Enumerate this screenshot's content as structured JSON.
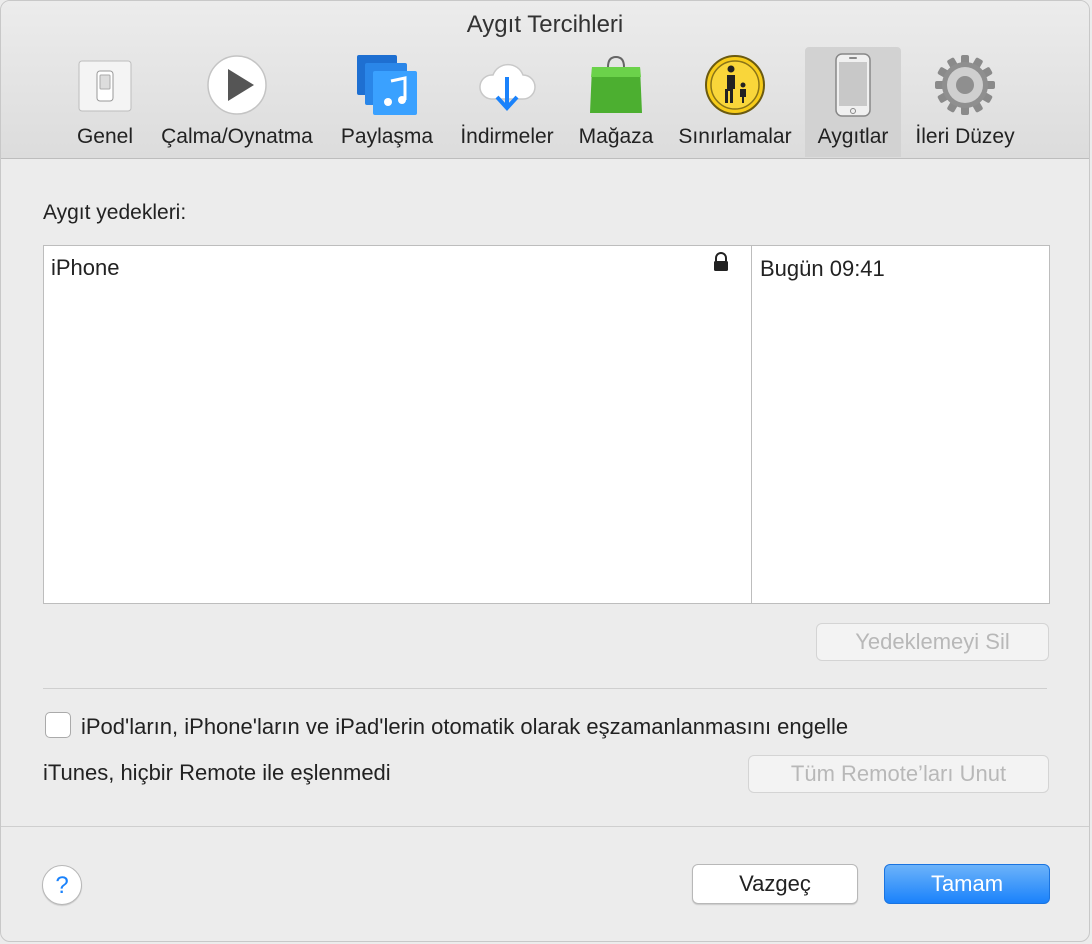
{
  "window": {
    "title": "Aygıt Tercihleri"
  },
  "toolbar": {
    "items": [
      {
        "label": "Genel",
        "icon": "general-switch-icon"
      },
      {
        "label": "Çalma/Oynatma",
        "icon": "play-icon"
      },
      {
        "label": "Paylaşma",
        "icon": "music-share-icon"
      },
      {
        "label": "İndirmeler",
        "icon": "cloud-download-icon"
      },
      {
        "label": "Mağaza",
        "icon": "shopping-bag-icon"
      },
      {
        "label": "Sınırlamalar",
        "icon": "parental-controls-icon"
      },
      {
        "label": "Aygıtlar",
        "icon": "iphone-icon",
        "selected": true
      },
      {
        "label": "İleri Düzey",
        "icon": "gear-icon"
      }
    ]
  },
  "backups": {
    "label": "Aygıt yedekleri:",
    "rows": [
      {
        "device": "iPhone",
        "date": "Bugün 09:41",
        "encrypted": true
      }
    ],
    "delete_button": "Yedeklemeyi Sil"
  },
  "sync": {
    "prevent_checkbox_label": "iPod'ların, iPhone'ların ve iPad'lerin otomatik olarak eşzamanlanmasını engelle",
    "prevent_checked": false
  },
  "remote": {
    "status_text": "iTunes, hiçbir Remote ile eşlenmedi",
    "forget_button": "Tüm Remote’ları Unut"
  },
  "footer": {
    "help": "?",
    "cancel": "Vazgeç",
    "ok": "Tamam"
  },
  "colors": {
    "accent": "#1a82fb",
    "selected_tab": "#d2d2d2"
  }
}
